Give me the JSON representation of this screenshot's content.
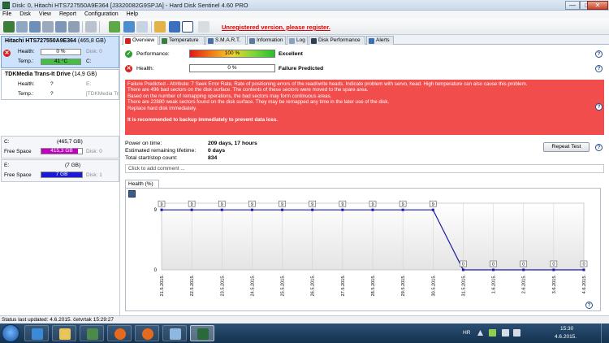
{
  "window": {
    "title": "Disk: 0, Hitachi HTS727550A9E364 [J3320082G9SPJA] - Hard Disk Sentinel 4.60 PRO",
    "minimize": "—",
    "maximize": "□",
    "close": "✕"
  },
  "menu": [
    "File",
    "Disk",
    "View",
    "Report",
    "Configuration",
    "Help"
  ],
  "toolbar": {
    "unregistered": "Unregistered version, please register."
  },
  "disks": [
    {
      "name": "Hitachi HTS727550A9E364",
      "size": "(465,8 GB)",
      "health_label": "Health:",
      "health_value": "0 %",
      "disk_ref": "Disk: 0",
      "temp_label": "Temp.:",
      "temp_value": "41 °C",
      "volume": "C:"
    },
    {
      "name": "TDKMedia Trans-It Drive",
      "size": "(14,9 GB)",
      "health_label": "Health:",
      "health_value": "?",
      "disk_ref": "E:",
      "temp_label": "Temp.:",
      "temp_value": "?",
      "volume": "[TDKMedia Trans-It"
    }
  ],
  "volumes": [
    {
      "letter": "C:",
      "size": "(465,7 GB)",
      "free_label": "Free Space",
      "free_value": "415,3 GB",
      "disk_ref": "Disk: 0",
      "color": "#c000c0",
      "fill": 0.89
    },
    {
      "letter": "E:",
      "size": "(7 GB)",
      "free_label": "Free Space",
      "free_value": "7 GB",
      "disk_ref": "Disk: 1",
      "color": "#1a1ad6",
      "fill": 1.0
    }
  ],
  "tabs": [
    "Overview",
    "Temperature",
    "S.M.A.R.T.",
    "Information",
    "Log",
    "Disk Performance",
    "Alerts"
  ],
  "overview": {
    "performance_label": "Performance:",
    "performance_value": "100 %",
    "performance_status": "Excellent",
    "health_label": "Health:",
    "health_value": "0 %",
    "health_status": "Failure Predicted",
    "alert_lines": [
      "Failure Predicted - Attribute: 7 Seek Error Rate, Rate of positioning errors of the read/write heads. Indicate problem with servo, head. High temperature can also cause this problem.",
      "There are 496 bad sectors on the disk surface. The contents of these sectors were moved to the spare area.",
      "Based on the number of remapping operations, the bad sectors may form continuous areas.",
      "There are 22880 weak sectors found on the disk surface. They may be remapped any time in the later use of the disk.",
      "Replace hard disk immediately.",
      "",
      "It is recommended to backup immediately to prevent data loss."
    ],
    "power_on_label": "Power on time:",
    "power_on_value": "209 days, 17 hours",
    "remaining_label": "Estimated remaining lifetime:",
    "remaining_value": "0 days",
    "startstop_label": "Total start/stop count:",
    "startstop_value": "834",
    "repeat_test": "Repeat Test",
    "comment_placeholder": "Click to add comment ..."
  },
  "chart_tab": "Health (%)",
  "chart_data": {
    "type": "line",
    "title": "Health (%)",
    "x": [
      "21.5.2015.",
      "22.5.2015.",
      "23.5.2015.",
      "24.5.2015.",
      "25.5.2015.",
      "26.5.2015.",
      "27.5.2015.",
      "28.5.2015.",
      "29.5.2015.",
      "30.5.2015.",
      "31.5.2015.",
      "1.6.2015.",
      "2.6.2015.",
      "3.6.2015.",
      "4.6.2015."
    ],
    "series": [
      {
        "values": [
          9,
          9,
          9,
          9,
          9,
          9,
          9,
          9,
          9,
          9,
          0,
          0,
          0,
          0,
          0
        ],
        "color": "#1a1aa8"
      }
    ],
    "point_labels": [
      "9",
      "9",
      "9",
      "9",
      "9",
      "9",
      "9",
      "9",
      "9",
      "9",
      "0",
      "0",
      "0",
      "0",
      "0"
    ],
    "ylim": [
      0,
      10
    ],
    "ytick_labels": [
      "9",
      "0"
    ]
  },
  "statusbar": "Status last updated: 4.6.2015. četvrtak 15:29:27",
  "taskbar": {
    "lang": "HR",
    "time": "15:30",
    "date": "4.6.2015."
  }
}
